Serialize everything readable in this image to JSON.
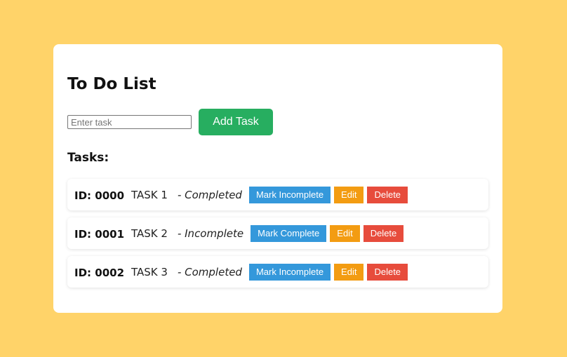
{
  "app": {
    "title": "To Do List"
  },
  "input": {
    "placeholder": "Enter task",
    "value": ""
  },
  "add_button": {
    "label": "Add Task"
  },
  "tasks_heading": "Tasks:",
  "tasks": [
    {
      "id": "ID: 0000",
      "name": "TASK 1",
      "status": "- Completed",
      "toggle_label": "Mark Incomplete",
      "edit_label": "Edit",
      "delete_label": "Delete"
    },
    {
      "id": "ID: 0001",
      "name": "TASK 2",
      "status": "- Incomplete",
      "toggle_label": "Mark Complete",
      "edit_label": "Edit",
      "delete_label": "Delete"
    },
    {
      "id": "ID: 0002",
      "name": "TASK 3",
      "status": "- Completed",
      "toggle_label": "Mark Incomplete",
      "edit_label": "Edit",
      "delete_label": "Delete"
    }
  ],
  "colors": {
    "background": "#ffd369",
    "add_button": "#27ae60",
    "toggle_button": "#3498db",
    "edit_button": "#f39c12",
    "delete_button": "#e74c3c"
  }
}
